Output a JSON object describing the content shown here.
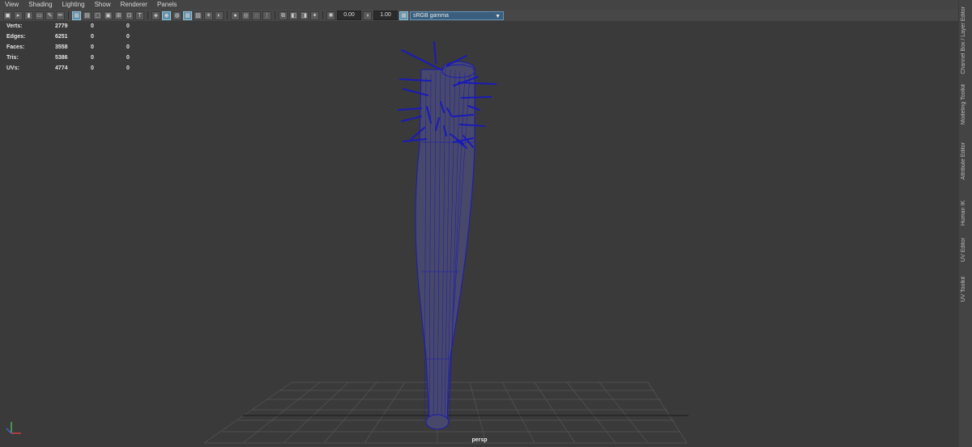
{
  "menu": [
    "View",
    "Shading",
    "Lighting",
    "Show",
    "Renderer",
    "Panels"
  ],
  "toolbar": {
    "exposure": "0.00",
    "gamma": "1.00",
    "color_space": "sRGB gamma"
  },
  "hud": {
    "rows": [
      {
        "label": "Verts:",
        "values": [
          "2779",
          "0",
          "0"
        ]
      },
      {
        "label": "Edges:",
        "values": [
          "6251",
          "0",
          "0"
        ]
      },
      {
        "label": "Faces:",
        "values": [
          "3558",
          "0",
          "0"
        ]
      },
      {
        "label": "Tris:",
        "values": [
          "5386",
          "0",
          "0"
        ]
      },
      {
        "label": "UVs:",
        "values": [
          "4774",
          "0",
          "0"
        ]
      }
    ]
  },
  "camera_label": "persp",
  "right_tabs": [
    "Channel Box / Layer Editor",
    "Modeling Toolkit",
    "Attribute Editor",
    "Human IK",
    "UV Editor",
    "UV Toolkit"
  ],
  "colors": {
    "wire": "#1a1ab8",
    "mesh": "#48486a",
    "grid": "#555555"
  }
}
